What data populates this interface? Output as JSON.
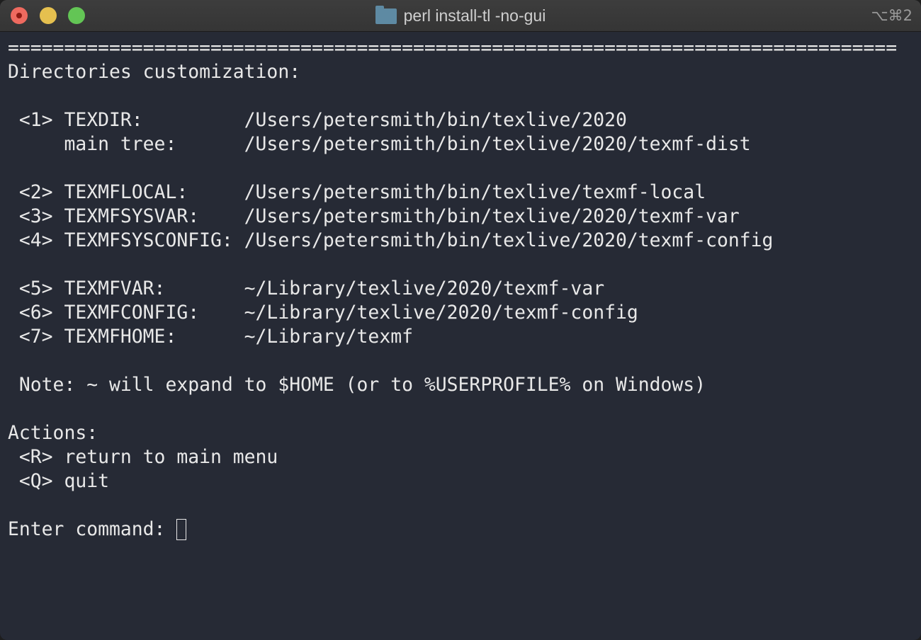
{
  "window": {
    "title": "perl install-tl -no-gui",
    "shortcut": "⌥⌘2"
  },
  "terminal": {
    "lines": [
      "===============================================================================",
      "Directories customization:",
      "",
      " <1> TEXDIR:         /Users/petersmith/bin/texlive/2020",
      "     main tree:      /Users/petersmith/bin/texlive/2020/texmf-dist",
      "",
      " <2> TEXMFLOCAL:     /Users/petersmith/bin/texlive/texmf-local",
      " <3> TEXMFSYSVAR:    /Users/petersmith/bin/texlive/2020/texmf-var",
      " <4> TEXMFSYSCONFIG: /Users/petersmith/bin/texlive/2020/texmf-config",
      "",
      " <5> TEXMFVAR:       ~/Library/texlive/2020/texmf-var",
      " <6> TEXMFCONFIG:    ~/Library/texlive/2020/texmf-config",
      " <7> TEXMFHOME:      ~/Library/texmf",
      "",
      " Note: ~ will expand to $HOME (or to %USERPROFILE% on Windows)",
      "",
      "Actions:",
      " <R> return to main menu",
      " <Q> quit",
      ""
    ],
    "prompt": "Enter command: "
  }
}
